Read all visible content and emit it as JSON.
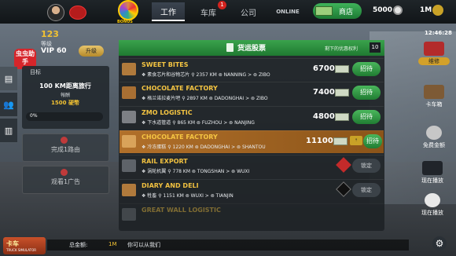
{
  "topbar": {
    "wheel_label": "BONUS",
    "tabs": [
      {
        "label": "工作",
        "active": true
      },
      {
        "label": "车库",
        "badge": "1"
      },
      {
        "label": "公司"
      },
      {
        "label": "ONLINE"
      }
    ],
    "shop_label": "商店",
    "coins": "5000",
    "money": "1M"
  },
  "profile": {
    "level": "123",
    "level_label": "等级",
    "vip": "VIP 60",
    "upgrade_label": "升级",
    "helper_label": "虫虫助手"
  },
  "goal": {
    "label": "目标",
    "target": "100 KM距离旅行",
    "reward_label": "報酬",
    "reward": "1500 硬幣",
    "progress_text": "0%",
    "progress": 0
  },
  "tasks": [
    {
      "label": "完成1路由"
    },
    {
      "label": "观看1广告"
    }
  ],
  "cargo": {
    "title": "货运股票",
    "remaining_label": "剩下的优惠权利",
    "remaining_count": "10",
    "rows": [
      {
        "name": "SWEET BITES",
        "cargo": "素食芯片和谷物芯片",
        "dist": "2357 KM",
        "from": "NANNING",
        "to": "ZIBO",
        "price": "6700",
        "action": "招待",
        "locked": false,
        "icon_color": "#b07a3c"
      },
      {
        "name": "CHOCOLATE FACTORY",
        "cargo": "格兰诺拉麦片吧",
        "dist": "2897 KM",
        "from": "DADONGHAI",
        "to": "ZIBO",
        "price": "7400",
        "action": "招待",
        "locked": false,
        "icon_color": "#a86f33"
      },
      {
        "name": "ZMO LOGISTIC",
        "cargo": "下水道管道",
        "dist": "865 KM",
        "from": "FUZHOU",
        "to": "NANJING",
        "price": "4800",
        "action": "招待",
        "locked": false,
        "icon_color": "#7d8085"
      },
      {
        "name": "CHOCOLATE FACTORY",
        "cargo": "冷冻蛋糕",
        "dist": "1220 KM",
        "from": "DADONGHAI",
        "to": "SHANTOU",
        "price": "11100",
        "action": "招待",
        "locked": false,
        "highlight": true,
        "icon_color": "#d9a35a"
      },
      {
        "name": "RAIL EXPORT",
        "cargo": "涡轮机翼",
        "dist": "778 KM",
        "from": "TONGSHAN",
        "to": "WUXI",
        "price": "",
        "action": "锁定",
        "locked": true,
        "icon_color": "#5e6369"
      },
      {
        "name": "DIARY AND DELI",
        "cargo": "牲畜",
        "dist": "1151 KM",
        "from": "WUXI",
        "to": "TIANJIN",
        "price": "",
        "action": "锁定",
        "locked": true,
        "icon_color": "#b07a3c"
      },
      {
        "name": "GREAT WALL LOGISTIC",
        "cargo": "",
        "dist": "",
        "from": "",
        "to": "",
        "price": "",
        "action": "",
        "locked": true,
        "icon_color": "#6d7277"
      }
    ]
  },
  "right": {
    "timer": "12:46:28",
    "items": [
      {
        "label": "维修"
      },
      {
        "label": "卡车箱"
      },
      {
        "label": "免费金额"
      },
      {
        "label": "现在播放"
      },
      {
        "label": "现在播放"
      }
    ]
  },
  "bottom": {
    "total_label": "总金额:",
    "total_value": "1M",
    "message": "你可以从我们",
    "logo_text": "卡车",
    "logo_sub": "TRUCK SIMULATOR"
  }
}
